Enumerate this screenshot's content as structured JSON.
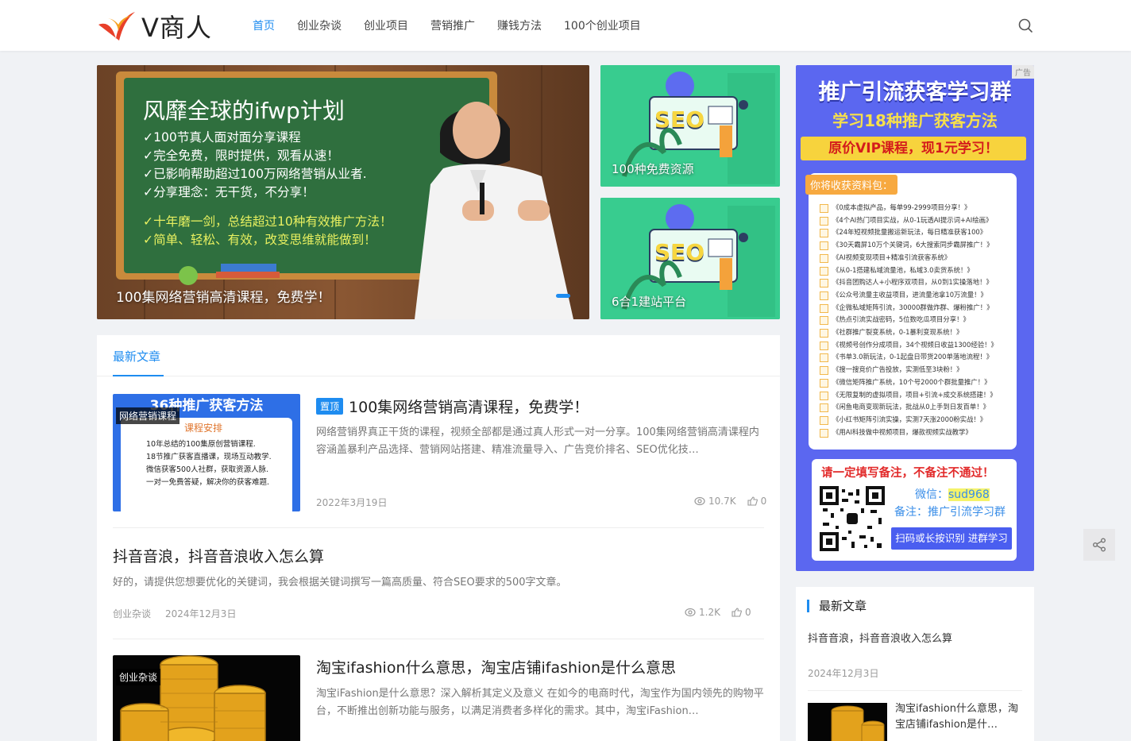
{
  "site": {
    "logo_text": "V商人"
  },
  "nav": {
    "items": [
      {
        "label": "首页",
        "active": true
      },
      {
        "label": "创业杂谈"
      },
      {
        "label": "创业项目"
      },
      {
        "label": "营销推广"
      },
      {
        "label": "赚钱方法"
      },
      {
        "label": "100个创业项目"
      }
    ],
    "search_icon": "search-icon"
  },
  "hero": {
    "main": {
      "board_title": "风靡全球的ifwp计划",
      "board_lines": [
        "✓100节真人面对面分享课程",
        "✓完全免费，限时提供，观看从速！",
        "✓已影响帮助超过100万网络营销从业者.",
        "✓分享理念：无干货，不分享！"
      ],
      "board_lines2": [
        "✓十年磨一剑，总结超过10种有效推广方法！",
        "✓简单、轻松、有效，改变思维就能做到！"
      ],
      "caption": "100集网络营销高清课程，免费学！"
    },
    "side": [
      {
        "caption": "100种免费资源",
        "art_text": "SEO"
      },
      {
        "caption": "6合1建站平台",
        "art_text": "SEO"
      }
    ]
  },
  "ad": {
    "tag": "广告",
    "title1": "推广引流获客学习群",
    "title2": "学习18种推广获客方法",
    "title3": "原价VIP课程，现1元学习！",
    "list_head": "你将收获资料包：",
    "items": [
      "《0成本虚拟产品，每单99-2999项目分享！》",
      "《4个AI热门项目实战，从0-1玩透AI提示词+AI绘画》",
      "《24年短视频批量搬运新玩法，每日精准获客100》",
      "《30天霸屏10万个关键词，6大搜索同步霸屏推广！》",
      "《AI视频变现项目+精准引流获客系统》",
      "《从0-1搭建私域流量池，私域3.0卖货系统！》",
      "《抖音团购达人+小程序双项目，从0到1实操落地！》",
      "《公众号流量主收益项目，进流量池拿10万流量！》",
      "《企微私域矩阵引流，30000群做炸群、爆粉推广！》",
      "《热点引流实战密码，5位数吃瓜项目分享！》",
      "《社群推广裂变系统，0-1暴利变现系统！》",
      "《视频号创作分成项目，34个视频日收益1300经验！》",
      "《书单3.0新玩法，0-1起盘日带货200单落地流程！》",
      "《搜一搜竞价广告投放，实测低至3块粉！》",
      "《微信矩阵推广系统，10个号2000个群批量推广！》",
      "《无限复制的虚拟项目，项目+引流+成交系统搭建！》",
      "《闲鱼电商变现新玩法，批战从0上手到日发百单！》",
      "《小红书矩阵引流实操，实测7天涨2000粉实战！》",
      "《用AI科技做中视频项目，爆款视频实战教学》"
    ],
    "warn": "请一定填写备注，不备注不通过！",
    "wechat_label": "微信：",
    "wechat_id": "sud968",
    "note": "备注：推广引流学习群",
    "scan": "扫码或长按识别 进群学习"
  },
  "main": {
    "tab": "最新文章",
    "posts": [
      {
        "thumb_tag": "网络营销课程",
        "thumb_title": "36种推广获客方法",
        "thumb_sub": "课程安排",
        "thumb_points": [
          "10年总结的100集原创营销课程.",
          "18节推广获客直播课，现场互动教学.",
          "微信获客500人社群，获取资源人脉.",
          "一对一免费答疑，解决你的获客难题."
        ],
        "badge": "置顶",
        "title": "100集网络营销高清课程，免费学！",
        "excerpt": "网络营销界真正干货的课程，视频全部都是通过真人形式一对一分享。100集网络营销高清课程内容涵盖暴利产品选择、营销网站搭建、精准流量导入、广告竞价排名、SEO优化技…",
        "date": "2022年3月19日",
        "views": "10.7K",
        "likes": "0"
      },
      {
        "title": "抖音音浪，抖音音浪收入怎么算",
        "excerpt": "好的，请提供您想要优化的关键词，我会根据关键词撰写一篇高质量、符合SEO要求的500字文章。",
        "category": "创业杂谈",
        "date": "2024年12月3日",
        "views": "1.2K",
        "likes": "0"
      },
      {
        "thumb_tag": "创业杂谈",
        "title": "淘宝ifashion什么意思，淘宝店铺ifashion是什么意思",
        "excerpt": "淘宝iFashion是什么意思？深入解析其定义及意义 在如今的电商时代，淘宝作为国内领先的购物平台，不断推出创新功能与服务，以满足消费者多样化的需求。其中，淘宝iFashion…"
      }
    ]
  },
  "sidebar": {
    "title": "最新文章",
    "items": [
      {
        "title": "抖音音浪，抖音音浪收入怎么算",
        "date": "2024年12月3日"
      },
      {
        "title": "淘宝ifashion什么意思，淘宝店铺ifashion是什…"
      }
    ]
  },
  "colors": {
    "accent": "#1e8cf0",
    "ad_bg": "#5b67f0",
    "gold": "#f6c544"
  }
}
